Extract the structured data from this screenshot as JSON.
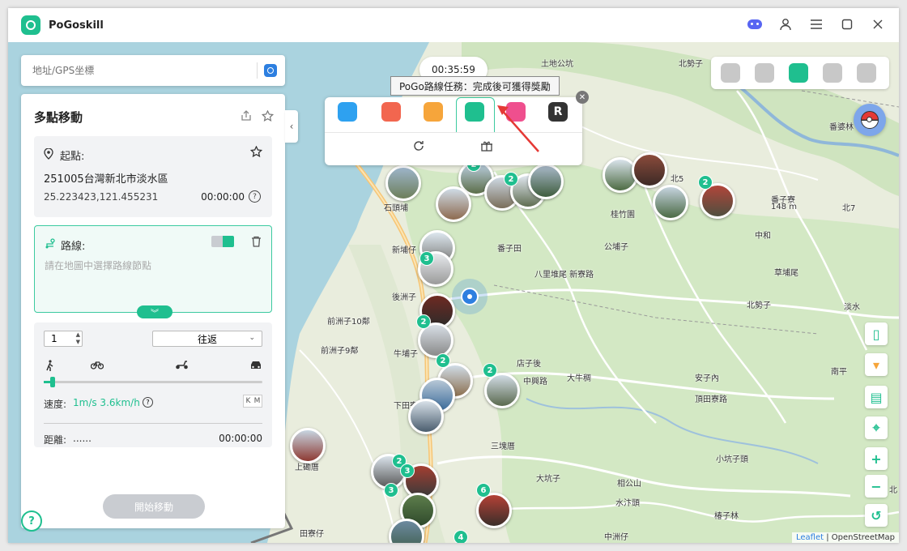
{
  "app": {
    "title": "PoGoskill"
  },
  "search": {
    "placeholder": "地址/GPS坐標"
  },
  "panel": {
    "title": "多點移動",
    "start": {
      "label": "起點:",
      "address": "251005台灣新北市淡水區",
      "coords": "25.223423,121.455231",
      "time": "00:00:00"
    },
    "route": {
      "label": "路線:",
      "placeholder": "請在地圖中選擇路線節點"
    },
    "options": {
      "count": "1",
      "mode": "往返",
      "speed_label": "速度:",
      "speed_value": "1m/s 3.6km/h",
      "unit_k": "K",
      "unit_m": "M",
      "distance_label": "距離:",
      "distance_value": "......",
      "distance_time": "00:00:00",
      "speed_slider_percent": 4
    },
    "start_button": "開始移動"
  },
  "timer": "00:35:59",
  "tooltip": "PoGo路線任務：完成後可獲得獎勵",
  "popup": {
    "active_index": 5,
    "buttons": [
      "pogo",
      "monster",
      "location",
      "route-task",
      "cross",
      "r"
    ]
  },
  "mode_bar": {
    "active_index": 2
  },
  "map": {
    "attribution": {
      "leaflet": "Leaflet",
      "osm": "OpenStreetMap"
    },
    "places": [
      {
        "text": "土地公坑"
      },
      {
        "text": "北勢子"
      },
      {
        "text": "石頭埔"
      },
      {
        "text": "桂竹園"
      },
      {
        "text": "番子寮"
      },
      {
        "text": "148 m"
      },
      {
        "text": "北7"
      },
      {
        "text": "番子田"
      },
      {
        "text": "公埔子"
      },
      {
        "text": "新埔仔"
      },
      {
        "text": "八里堆尾 新寮路"
      },
      {
        "text": "草埔尾"
      },
      {
        "text": "中和"
      },
      {
        "text": "後洲子"
      },
      {
        "text": "北勢子"
      },
      {
        "text": "前洲子10鄰"
      },
      {
        "text": "前洲子9鄰"
      },
      {
        "text": "牛埔子"
      },
      {
        "text": "店子後"
      },
      {
        "text": "大牛稠"
      },
      {
        "text": "安子內"
      },
      {
        "text": "南平"
      },
      {
        "text": "中興路"
      },
      {
        "text": "頂田寮路"
      },
      {
        "text": "下田寮"
      },
      {
        "text": "三塊厝"
      },
      {
        "text": "大坑子"
      },
      {
        "text": "相公山"
      },
      {
        "text": "水汴頭"
      },
      {
        "text": "椿子林"
      },
      {
        "text": "上磡厝"
      },
      {
        "text": "田寮仔"
      },
      {
        "text": "中洲仔"
      },
      {
        "text": "番婆林"
      },
      {
        "text": "淡水"
      },
      {
        "text": "北"
      },
      {
        "text": "北5"
      },
      {
        "text": "小坑子頭"
      }
    ],
    "clusters": [
      "2",
      "2",
      "2",
      "3",
      "2",
      "2",
      "2",
      "2",
      "3",
      "3",
      "6",
      "4"
    ]
  }
}
